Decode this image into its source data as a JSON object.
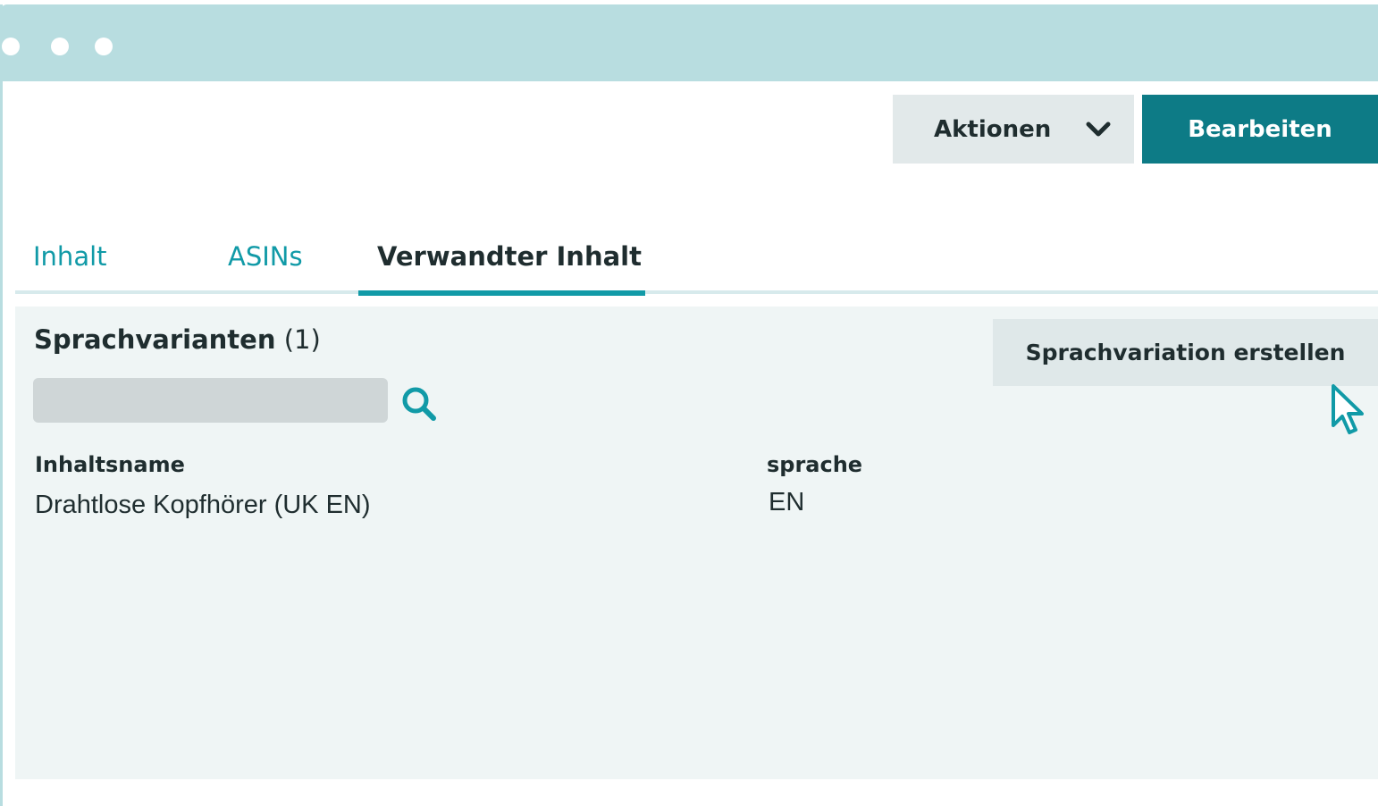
{
  "toolbar": {
    "actions_label": "Aktionen",
    "edit_label": "Bearbeiten"
  },
  "tabs": [
    {
      "label": "Inhalt",
      "active": false
    },
    {
      "label": "ASINs",
      "active": false
    },
    {
      "label": "Verwandter Inhalt",
      "active": true
    }
  ],
  "section": {
    "title": "Sprachvarianten",
    "count": "(1)",
    "create_button_label": "Sprachvariation erstellen",
    "search": {
      "value": "",
      "placeholder": ""
    }
  },
  "table": {
    "columns": [
      "Inhaltsname",
      "sprache"
    ],
    "rows": [
      [
        "Drahtlose Kopfhörer (UK EN)",
        "EN"
      ]
    ]
  },
  "icons": {
    "dropdown": "chevron-down-icon",
    "search": "search-icon",
    "cursor": "mouse-pointer-icon"
  },
  "colors": {
    "titlebar": "#b8dde0",
    "accent": "#119aa7",
    "primary_button": "#0d7b86",
    "panel_bg": "#eff5f5"
  }
}
